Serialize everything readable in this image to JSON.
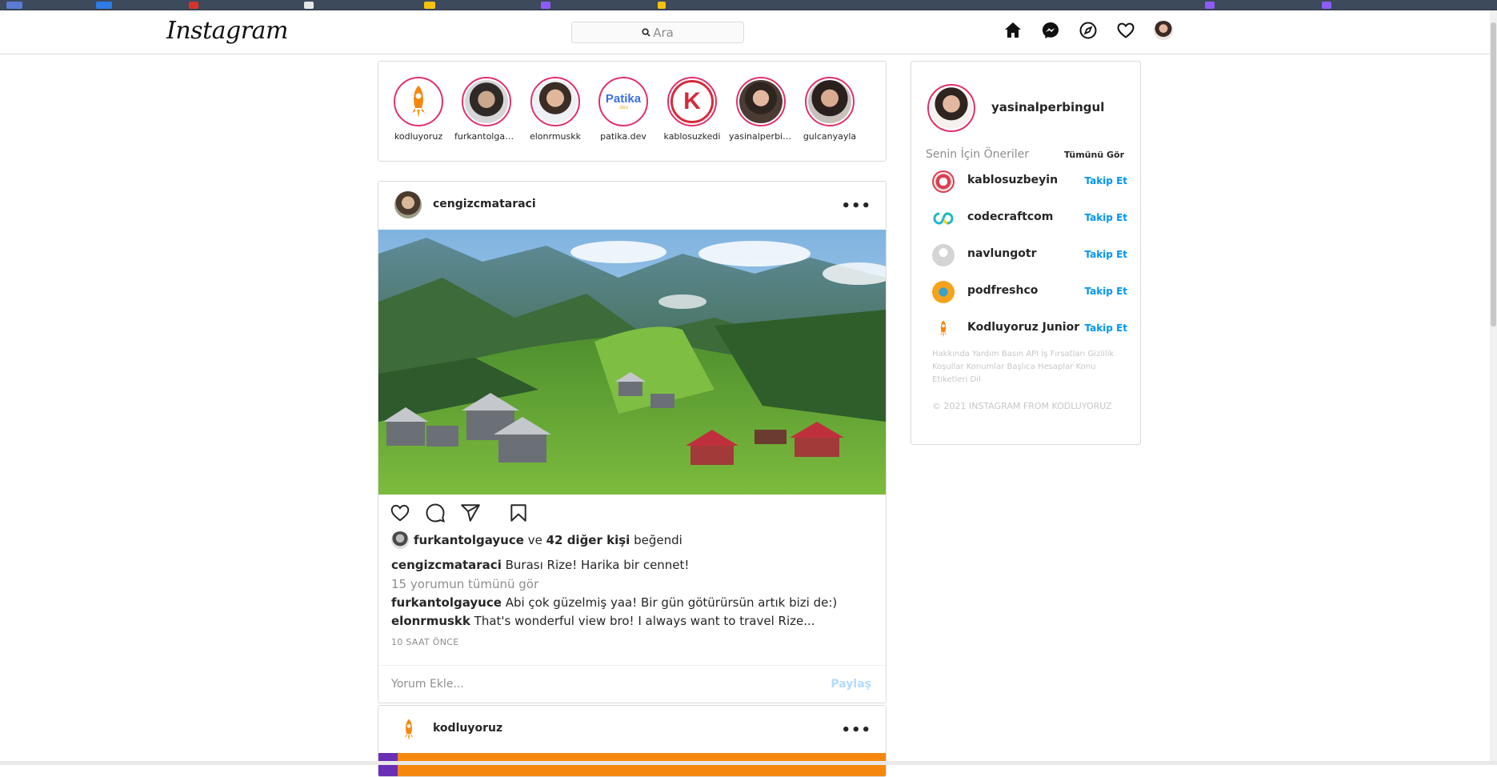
{
  "app": {
    "logo_text": "Instagram"
  },
  "search": {
    "placeholder": "Ara"
  },
  "nav": {
    "icons": [
      "home-icon",
      "messenger-icon",
      "explore-icon",
      "heart-icon",
      "profile-avatar"
    ]
  },
  "stories": [
    {
      "name": "kodluyoruz"
    },
    {
      "name": "furkantolgayuce"
    },
    {
      "name": "elonrmuskk"
    },
    {
      "name": "patika.dev",
      "logo_text": "Patika",
      "logo_sub": ".dev"
    },
    {
      "name": "kablosuzkedi",
      "logo_text": "K"
    },
    {
      "name": "yasinalperbingul"
    },
    {
      "name": "gulcanyayla"
    }
  ],
  "post": {
    "user": "cengizcmataraci",
    "more": "•••",
    "liked_by": "furkantolgayuce",
    "liked_joiner": "ve",
    "liked_others": "42 diğer kişi",
    "liked_suffix": "beğendi",
    "caption_user": "cengizcmataraci",
    "caption_text": "Burası Rize! Harika bir cennet!",
    "view_comments": "15 yorumun tümünü gör",
    "comments": [
      {
        "user": "furkantolgayuce",
        "text": "Abi çok güzelmiş yaa! Bir gün götürürsün artık bizi de:)"
      },
      {
        "user": "elonrmuskk",
        "text": "That's wonderful view bro! I always want to travel Rize..."
      }
    ],
    "time": "10 SAAT ÖNCE",
    "comment_placeholder": "Yorum Ekle...",
    "share_label": "Paylaş"
  },
  "post2": {
    "user": "kodluyoruz",
    "more": "•••"
  },
  "sidebar": {
    "username": "yasinalperbingul",
    "suggestions_title": "Senin İçin Öneriler",
    "see_all": "Tümünü Gör",
    "follow_label": "Takip Et",
    "suggestions": [
      {
        "name": "kablosuzbeyin",
        "color": "#d9404f"
      },
      {
        "name": "codecraftcom",
        "color": "#22b7c9"
      },
      {
        "name": "navlungotr",
        "color": "#cfcfcf"
      },
      {
        "name": "podfreshco",
        "color": "#f7a21b"
      },
      {
        "name": "Kodluyoruz Junior",
        "color": "#f5870f"
      }
    ],
    "footer_links": "Hakkında Yardım Basın API İş Fırsatları Gizlilik Koşullar Konumlar Başlıca Hesaplar Konu Etiketleri Dil",
    "copyright": "© 2021 INSTAGRAM FROM KODLUYORUZ"
  }
}
